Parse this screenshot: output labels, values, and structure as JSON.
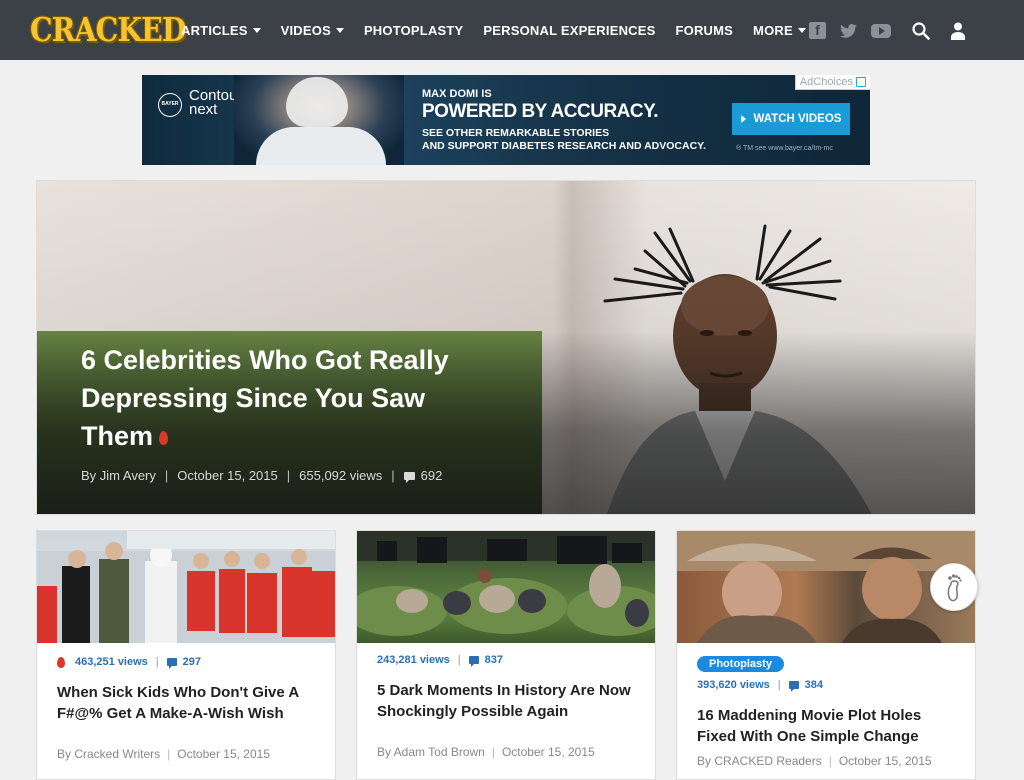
{
  "header": {
    "logo": "CRACKED",
    "nav": [
      {
        "label": "ARTICLES",
        "dropdown": true
      },
      {
        "label": "VIDEOS",
        "dropdown": true
      },
      {
        "label": "PHOTOPLASTY",
        "dropdown": false
      },
      {
        "label": "PERSONAL EXPERIENCES",
        "dropdown": false
      },
      {
        "label": "FORUMS",
        "dropdown": false
      },
      {
        "label": "MORE",
        "dropdown": true
      }
    ],
    "social_icons": [
      "facebook-icon",
      "twitter-icon",
      "youtube-icon"
    ],
    "colors": {
      "bar": "#3b4147",
      "logo": "#f6c431"
    }
  },
  "ad": {
    "adchoices": "AdChoices",
    "brand_badge": "BAYER",
    "brand_line1": "Contour",
    "brand_line2": "next",
    "headline_small": "MAX DOMI IS",
    "headline": "POWERED BY ACCURACY.",
    "sub_line1": "SEE OTHER REMARKABLE STORIES",
    "sub_line2": "AND SUPPORT DIABETES RESEARCH AND ADVOCACY.",
    "button": "WATCH VIDEOS",
    "trademark": "® TM see www.bayer.ca/tm-mc"
  },
  "hero": {
    "title": "6 Celebrities Who Got Really Depressing Since You Saw Them",
    "author": "By Jim Avery",
    "date": "October 15, 2015",
    "views": "655,092 views",
    "comments": "692"
  },
  "cards": [
    {
      "views": "463,251 views",
      "comments": "297",
      "hot": true,
      "title": "When Sick Kids Who Don't Give A F#@% Get A Make-A-Wish Wish",
      "author": "By Cracked Writers",
      "date": "October 15, 2015"
    },
    {
      "views": "243,281 views",
      "comments": "837",
      "hot": false,
      "title": "5 Dark Moments In History Are Now Shockingly Possible Again",
      "author": "By Adam Tod Brown",
      "date": "October 15, 2015"
    },
    {
      "badge": "Photoplasty",
      "views": "393,620 views",
      "comments": "384",
      "hot": false,
      "title": "16 Maddening Movie Plot Holes Fixed With One Simple Change",
      "author": "By CRACKED Readers",
      "date": "October 15, 2015"
    }
  ]
}
